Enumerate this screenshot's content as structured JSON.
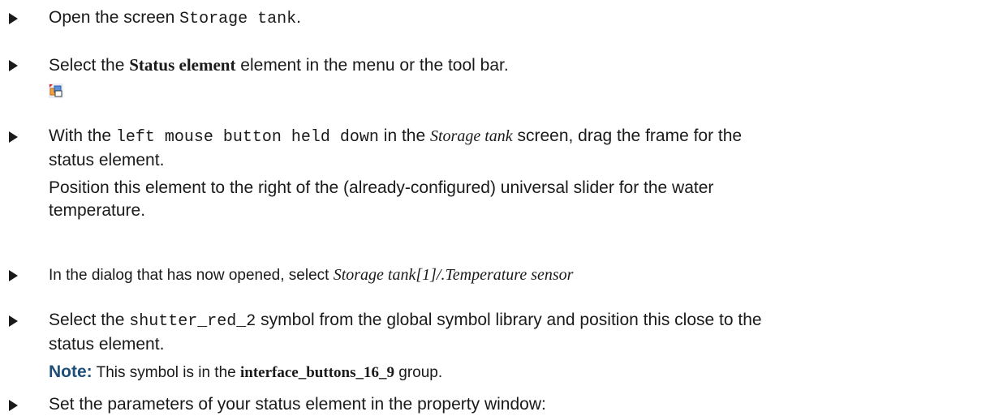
{
  "steps": [
    {
      "t1": "Open the screen ",
      "code": "Storage tank",
      "t2": "."
    },
    {
      "t1": "Select the ",
      "bold": "Status element",
      "t2": " element in the menu or the tool bar.",
      "icon": "status-element-tool-icon"
    },
    {
      "t1": "With the ",
      "code": "left mouse button held down",
      "t2": " in the ",
      "ital": "Storage tank",
      "t3": " screen, drag the frame for the",
      "l2": "status element.",
      "l3": "Position this element to the right of the (already-configured) universal slider for the water",
      "l4": "temperature."
    },
    {
      "t1": "In the dialog that has now opened, select ",
      "ital": "Storage tank[1]/.Temperature sensor"
    },
    {
      "t1": "Select the ",
      "code": "shutter_red_2",
      "t2": " symbol from the global symbol library and position this close to the",
      "l2": "status element.",
      "note_label": "Note:",
      "note_t1": " This symbol is in the ",
      "note_bold": "interface_buttons_16_9",
      "note_t2": " group."
    },
    {
      "t1": "Set the parameters of your status element in the property window:"
    }
  ],
  "colors": {
    "text": "#1a1a1a",
    "note": "#1f4e79"
  }
}
